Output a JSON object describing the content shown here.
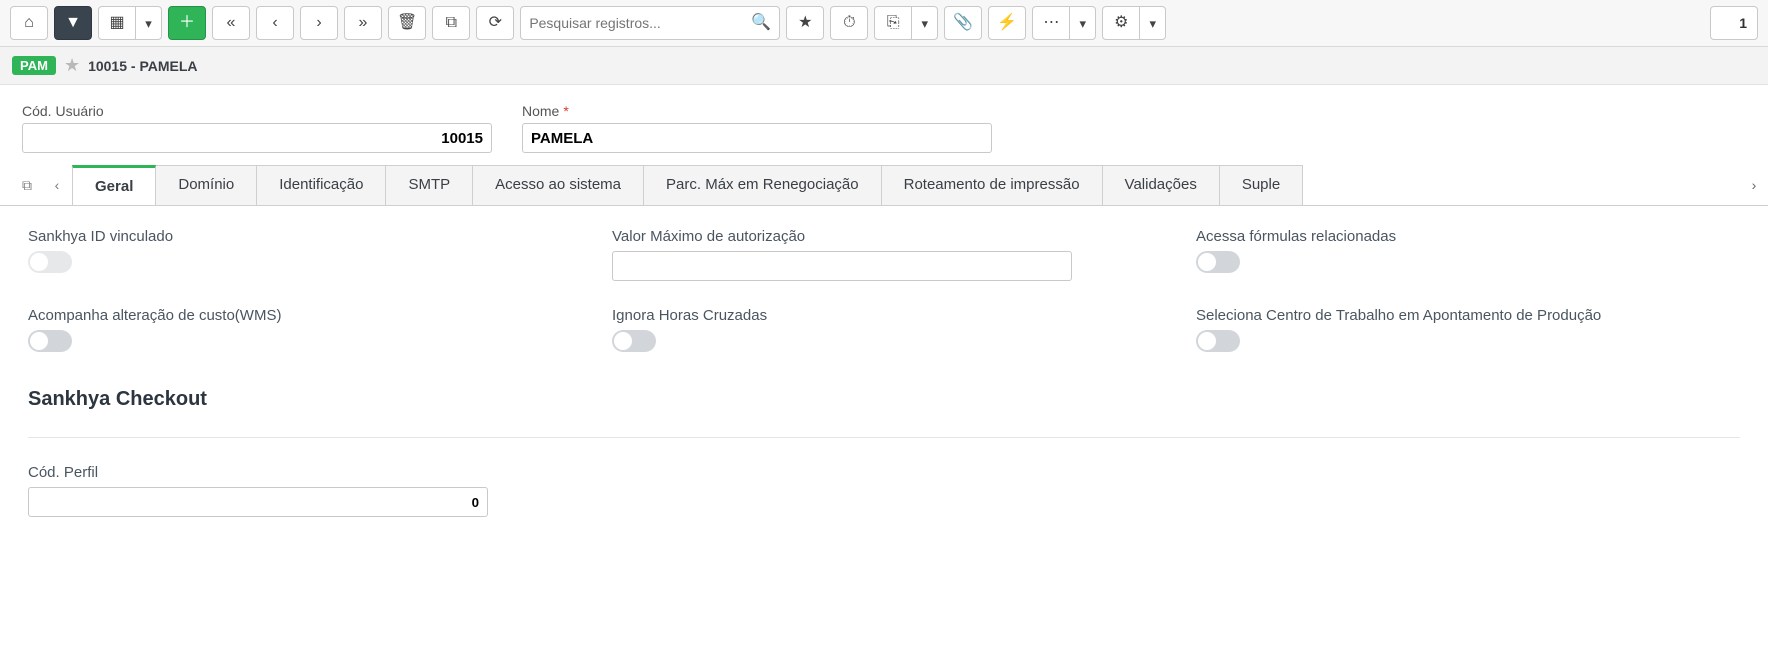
{
  "toolbar": {
    "search_placeholder": "Pesquisar registros...",
    "page_count": "1"
  },
  "record": {
    "badge": "PAM",
    "title": "10015 - PAMELA"
  },
  "header_fields": {
    "codigo_label": "Cód. Usuário",
    "codigo_value": "10015",
    "nome_label": "Nome",
    "nome_value": "PAMELA"
  },
  "tabs": {
    "items": [
      {
        "label": "Geral"
      },
      {
        "label": "Domínio"
      },
      {
        "label": "Identificação"
      },
      {
        "label": "SMTP"
      },
      {
        "label": "Acesso ao sistema"
      },
      {
        "label": "Parc. Máx em Renegociação"
      },
      {
        "label": "Roteamento de impressão"
      },
      {
        "label": "Validações"
      },
      {
        "label": "Suple"
      }
    ]
  },
  "panel": {
    "sankhya_id_label": "Sankhya ID vinculado",
    "valor_max_label": "Valor Máximo de autorização",
    "acessa_formulas_label": "Acessa fórmulas relacionadas",
    "acompanha_wms_label": "Acompanha alteração de custo(WMS)",
    "ignora_horas_label": "Ignora Horas Cruzadas",
    "seleciona_centro_label": "Seleciona Centro de Trabalho em Apontamento de Produção",
    "section_title": "Sankhya Checkout",
    "cod_perfil_label": "Cód. Perfil",
    "cod_perfil_value": "0"
  }
}
